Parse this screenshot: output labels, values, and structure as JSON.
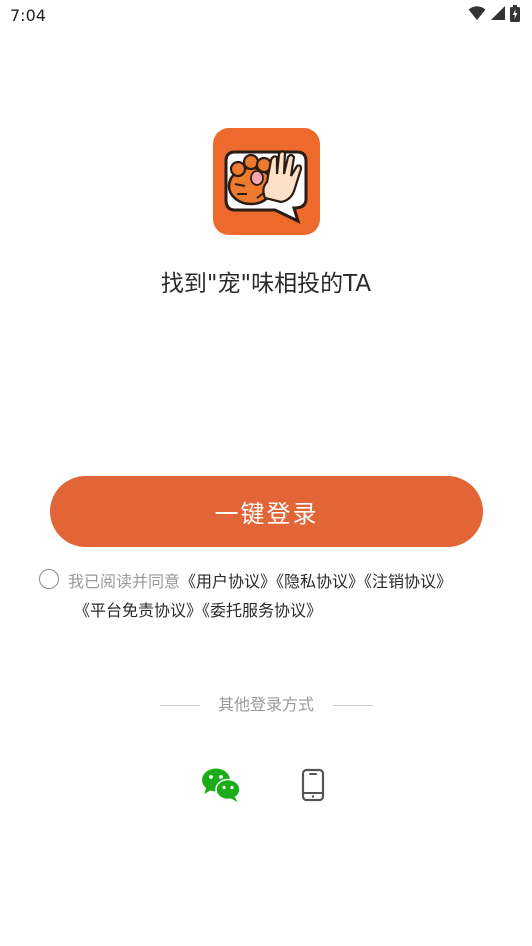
{
  "status_bar": {
    "time": "7:04",
    "icons": [
      "wifi-icon",
      "cellular-signal-icon",
      "battery-charging-icon"
    ]
  },
  "app": {
    "logo_icon": "tiger-paw-logo",
    "brand_color": "#EE6A2C",
    "tagline": "找到\"宠\"味相投的TA"
  },
  "login": {
    "one_click_label": "一键登录",
    "button_color": "#E26537"
  },
  "agreement": {
    "checked": false,
    "prefix": "我已阅读并同意",
    "links": [
      "《用户协议》",
      "《隐私协议》",
      "《注销协议》",
      "《平台免责协议》",
      "《委托服务协议》"
    ]
  },
  "other_login": {
    "label": "其他登录方式",
    "methods": [
      {
        "icon": "wechat-icon",
        "color": "#1AAD19"
      },
      {
        "icon": "phone-icon",
        "color": "#555555"
      }
    ]
  }
}
